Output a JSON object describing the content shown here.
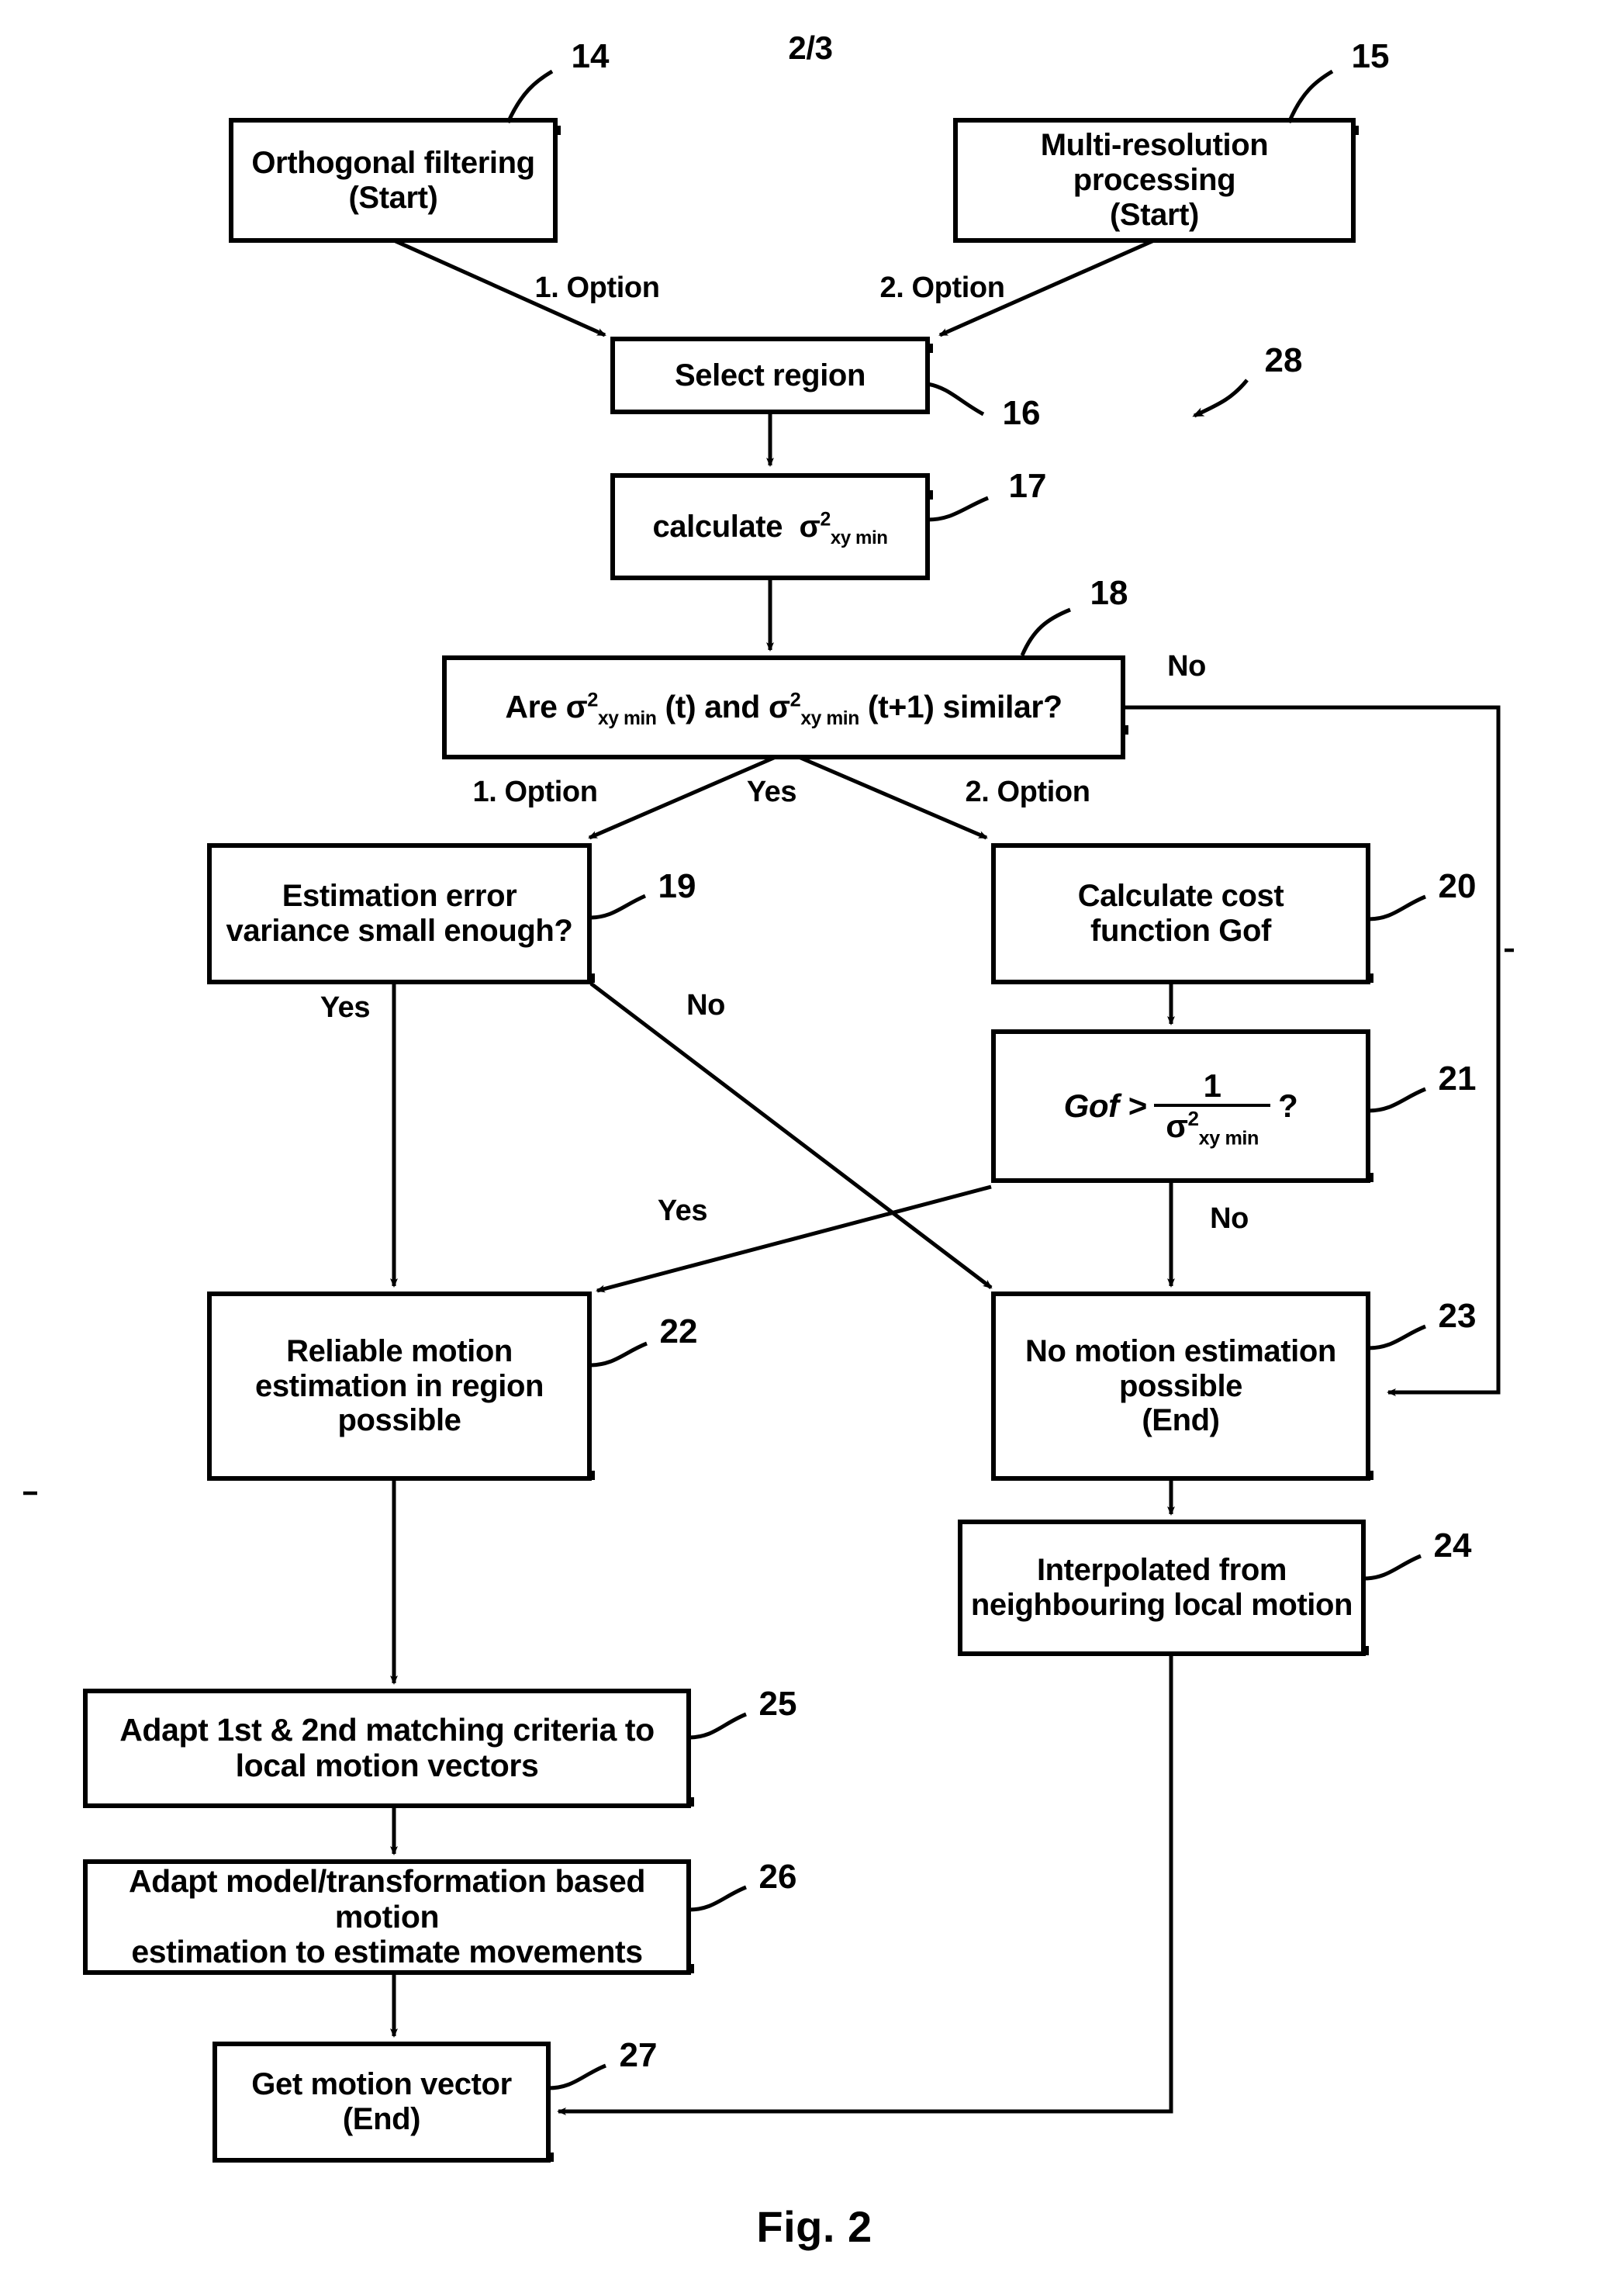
{
  "page": {
    "page_marker": "2/3",
    "figure_caption": "Fig. 2"
  },
  "reference_numerals": {
    "n14": "14",
    "n15": "15",
    "n16": "16",
    "n17": "17",
    "n18": "18",
    "n19": "19",
    "n20": "20",
    "n21": "21",
    "n22": "22",
    "n23": "23",
    "n24": "24",
    "n25": "25",
    "n26": "26",
    "n27": "27",
    "n28": "28"
  },
  "nodes": {
    "orthogonal_filtering": {
      "line1": "Orthogonal filtering",
      "line2": "(Start)"
    },
    "multi_resolution": {
      "line1": "Multi-resolution processing",
      "line2": "(Start)"
    },
    "select_region": {
      "line1": "Select region"
    },
    "calculate_sigma": {
      "prefix": "calculate",
      "symbol": "σ",
      "superscript": "2",
      "subscript": "xy min"
    },
    "similarity_decision": {
      "part1": "Are",
      "symbol": "σ",
      "superscript": "2",
      "subscript": "xy min",
      "arg1": "(t)",
      "part2": "and",
      "arg2": "(t+1) similar?"
    },
    "estimation_error": {
      "line1": "Estimation error",
      "line2": "variance small enough?"
    },
    "calculate_cost": {
      "line1": "Calculate cost",
      "line2": "function Gof"
    },
    "gof_threshold": {
      "lhs": "Gof >",
      "numerator": "1",
      "den_symbol": "σ",
      "den_superscript": "2",
      "den_subscript": "xy min",
      "question": "?"
    },
    "reliable_motion": {
      "line1": "Reliable motion",
      "line2": "estimation in region",
      "line3": "possible"
    },
    "no_motion": {
      "line1": "No motion estimation",
      "line2": "possible",
      "line3": "(End)"
    },
    "interpolated": {
      "line1": "Interpolated from",
      "line2": "neighbouring local motion"
    },
    "adapt_matching": {
      "line1": "Adapt 1st & 2nd matching criteria to",
      "line2": "local motion vectors"
    },
    "adapt_model": {
      "line1": "Adapt model/transformation based motion",
      "line2": "estimation to estimate movements"
    },
    "get_motion_vector": {
      "line1": "Get motion vector",
      "line2": "(End)"
    }
  },
  "edge_labels": {
    "option1_top": "1. Option",
    "option2_top": "2. Option",
    "decision18_no": "No",
    "decision18_option1": "1. Option",
    "decision18_yes": "Yes",
    "decision18_option2": "2. Option",
    "decision19_yes": "Yes",
    "decision19_no": "No",
    "decision21_yes": "Yes",
    "decision21_no": "No"
  },
  "colors": {
    "ink": "#000000",
    "paper": "#ffffff"
  }
}
